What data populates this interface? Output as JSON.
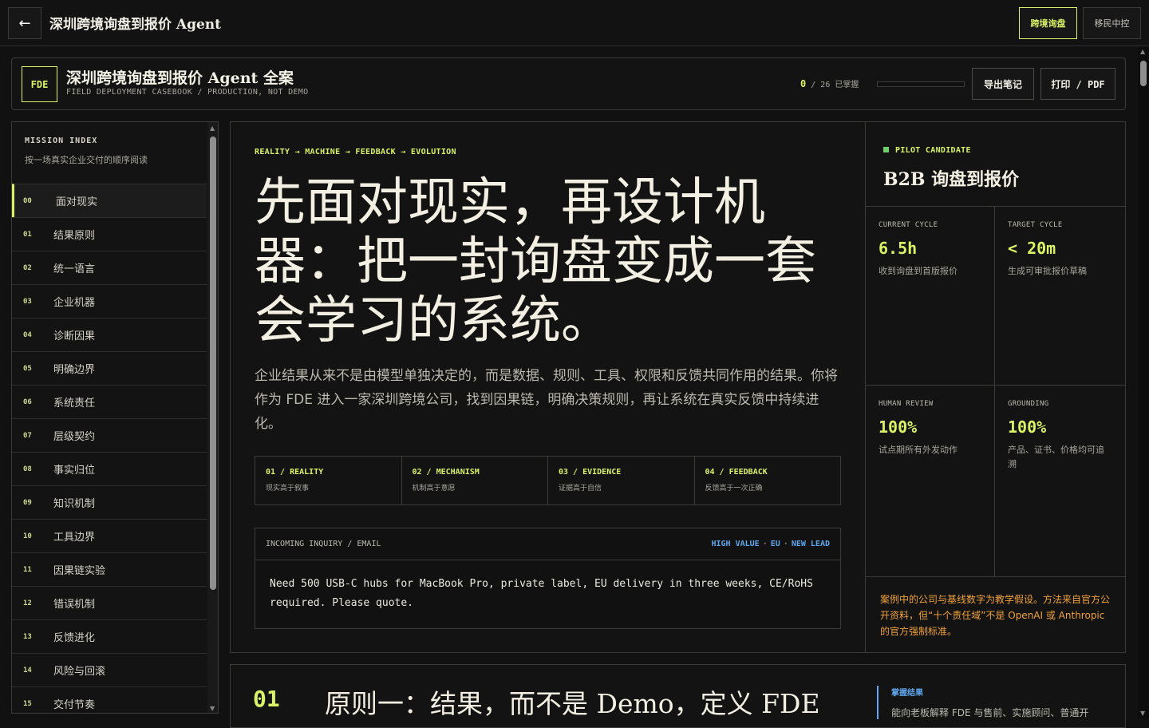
{
  "topbar": {
    "back_icon": "←",
    "title": "深圳跨境询盘到报价 Agent",
    "btn_primary": "跨境询盘",
    "btn_secondary": "移民中控"
  },
  "header": {
    "badge": "FDE",
    "title": "深圳跨境询盘到报价 Agent 全案",
    "subtitle": "FIELD DEPLOYMENT CASEBOOK / PRODUCTION, NOT DEMO",
    "progress_done": "0",
    "progress_total": "/ 26 已掌握",
    "progress_fraction": 0,
    "export_label": "导出笔记",
    "print_label": "打印 / PDF"
  },
  "sidebar": {
    "title": "MISSION INDEX",
    "subtitle": "按一场真实企业交付的顺序阅读",
    "items": [
      {
        "num": "00",
        "label": "面对现实"
      },
      {
        "num": "01",
        "label": "结果原则"
      },
      {
        "num": "02",
        "label": "统一语言"
      },
      {
        "num": "03",
        "label": "企业机器"
      },
      {
        "num": "04",
        "label": "诊断因果"
      },
      {
        "num": "05",
        "label": "明确边界"
      },
      {
        "num": "06",
        "label": "系统责任"
      },
      {
        "num": "07",
        "label": "层级契约"
      },
      {
        "num": "08",
        "label": "事实归位"
      },
      {
        "num": "09",
        "label": "知识机制"
      },
      {
        "num": "10",
        "label": "工具边界"
      },
      {
        "num": "11",
        "label": "因果链实验"
      },
      {
        "num": "12",
        "label": "错误机制"
      },
      {
        "num": "13",
        "label": "反馈进化"
      },
      {
        "num": "14",
        "label": "风险与回滚"
      },
      {
        "num": "15",
        "label": "交付节奏"
      }
    ]
  },
  "main": {
    "crumb": "REALITY → MACHINE → FEEDBACK → EVOLUTION",
    "hero": "先面对现实，再设计机器：把一封询盘变成一套会学习的系统。",
    "lead": "企业结果从来不是由模型单独决定的，而是数据、规则、工具、权限和反馈共同作用的结果。你将作为 FDE 进入一家深圳跨境公司，找到因果链，明确决策规则，再让系统在真实反馈中持续进化。",
    "steps": [
      {
        "title": "01 / REALITY",
        "sub": "现实高于叙事"
      },
      {
        "title": "02 / MECHANISM",
        "sub": "机制高于意愿"
      },
      {
        "title": "03 / EVIDENCE",
        "sub": "证据高于自信"
      },
      {
        "title": "04 / FEEDBACK",
        "sub": "反馈高于一次正确"
      }
    ],
    "inquiry": {
      "label": "INCOMING INQUIRY / EMAIL",
      "tag1": "HIGH VALUE",
      "sep": "·",
      "tag2": "EU",
      "tag3": "NEW LEAD",
      "body": "Need 500 USB-C hubs for MacBook Pro, private label, EU delivery in three weeks, CE/RoHS required. Please quote."
    }
  },
  "pilot": {
    "tag": "PILOT CANDIDATE",
    "title": "B2B 询盘到报价",
    "metrics": [
      {
        "label": "CURRENT CYCLE",
        "value": "6.5h",
        "desc": "收到询盘到首版报价"
      },
      {
        "label": "TARGET CYCLE",
        "value": "< 20m",
        "desc": "生成可审批报价草稿"
      },
      {
        "label": "HUMAN REVIEW",
        "value": "100%",
        "desc": "试点期所有外发动作"
      },
      {
        "label": "GROUNDING",
        "value": "100%",
        "desc": "产品、证书、价格均可追溯"
      }
    ],
    "disclaimer": "案例中的公司与基线数字为教学假设。方法来自官方公开资料，但“十个责任域”不是 OpenAI 或 Anthropic 的官方强制标准。"
  },
  "section": {
    "num": "01",
    "title": "原则一：结果，而不是 Demo，定义 FDE",
    "side_title": "掌握结果",
    "side_sub": "能向老板解释 FDE 与售前、实施顾问、普通开"
  },
  "colors": {
    "accent": "#d9f266",
    "info": "#5fa8f0",
    "warn": "#f2a23c"
  }
}
